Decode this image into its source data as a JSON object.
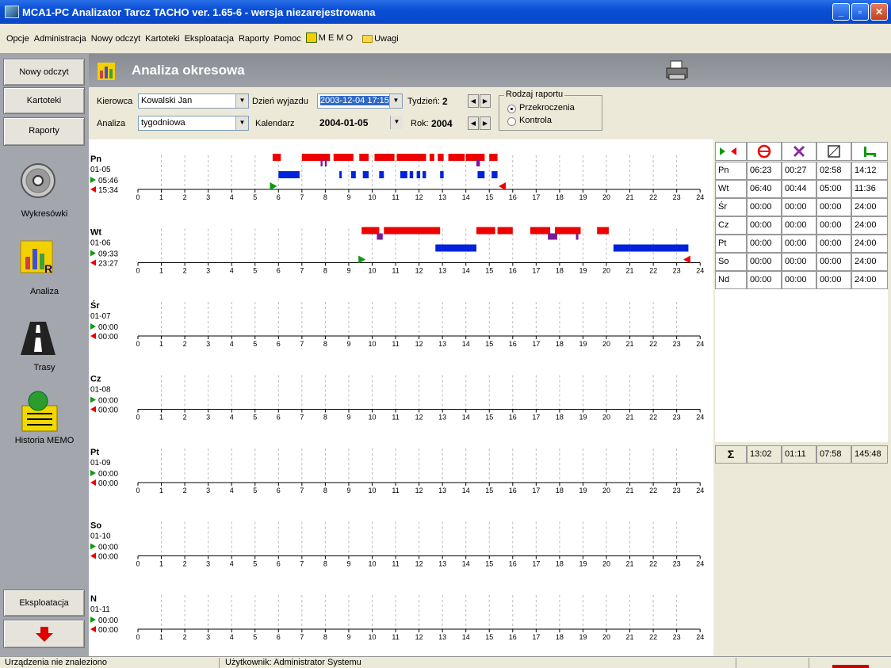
{
  "window": {
    "title": "MCA1-PC Analizator Tarcz TACHO  ver. 1.65-6   - wersja niezarejestrowana"
  },
  "menu": [
    "Opcje",
    "Administracja",
    "Nowy odczyt",
    "Kartoteki",
    "Eksploatacja",
    "Raporty",
    "Pomoc"
  ],
  "menu_memo": "M E M O",
  "menu_uwagi": "Uwagi",
  "sidebar": {
    "nowy_odczyt": "Nowy odczyt",
    "kartoteki": "Kartoteki",
    "raporty": "Raporty",
    "wykresowki": "Wykresówki",
    "analiza": "Analiza",
    "trasy": "Trasy",
    "historia": "Historia MEMO",
    "eksploatacja": "Eksploatacja"
  },
  "header": {
    "title": "Analiza okresowa"
  },
  "form": {
    "kierowca_label": "Kierowca",
    "kierowca_value": "Kowalski Jan",
    "dzien_label": "Dzień wyjazdu",
    "dzien_value": "2003-12-04 17:15",
    "tydzien_label": "Tydzień:",
    "tydzien_value": "2",
    "analiza_label": "Analiza",
    "analiza_value": "tygodniowa",
    "kalendarz_label": "Kalendarz",
    "kalendarz_value": "2004-01-05",
    "rok_label": "Rok:",
    "rok_value": "2004",
    "rodzaj_label": "Rodzaj raportu",
    "opt1": "Przekroczenia",
    "opt2": "Kontrola"
  },
  "colors": {
    "red": "#ee0000",
    "blue": "#0022dd",
    "purple": "#7a1a9a",
    "green": "#119911"
  },
  "days": [
    {
      "name": "Pn",
      "date": "01-05",
      "start": "05:46",
      "end": "15:34",
      "start_h": 5.77,
      "end_h": 15.57,
      "red": [
        [
          5.75,
          6.1
        ],
        [
          7.0,
          8.2
        ],
        [
          8.35,
          9.2
        ],
        [
          9.45,
          9.85
        ],
        [
          10.1,
          10.95
        ],
        [
          11.05,
          12.3
        ],
        [
          12.45,
          12.65
        ],
        [
          12.8,
          13.05
        ],
        [
          13.25,
          13.95
        ],
        [
          14.0,
          14.8
        ],
        [
          15.0,
          15.35
        ]
      ],
      "purple": [
        [
          7.8,
          7.88
        ],
        [
          7.98,
          8.06
        ],
        [
          14.45,
          14.6
        ]
      ],
      "blue": [
        [
          6.0,
          6.9
        ],
        [
          8.6,
          8.7
        ],
        [
          9.1,
          9.3
        ],
        [
          9.6,
          9.85
        ],
        [
          10.3,
          10.5
        ],
        [
          11.2,
          11.5
        ],
        [
          11.6,
          11.75
        ],
        [
          11.9,
          12.05
        ],
        [
          12.15,
          12.3
        ],
        [
          12.9,
          13.05
        ],
        [
          14.5,
          14.8
        ],
        [
          15.1,
          15.35
        ]
      ]
    },
    {
      "name": "Wt",
      "date": "01-06",
      "start": "09:33",
      "end": "23:27",
      "start_h": 9.55,
      "end_h": 23.45,
      "red": [
        [
          9.55,
          10.3
        ],
        [
          10.5,
          12.9
        ],
        [
          14.45,
          15.25
        ],
        [
          15.35,
          16.0
        ],
        [
          16.75,
          17.6
        ],
        [
          17.8,
          18.9
        ],
        [
          19.6,
          20.1
        ]
      ],
      "purple": [
        [
          10.2,
          10.45
        ],
        [
          17.5,
          17.9
        ],
        [
          18.7,
          18.8
        ]
      ],
      "blue": [
        [
          12.7,
          14.45
        ],
        [
          20.3,
          23.5
        ]
      ]
    },
    {
      "name": "Śr",
      "date": "01-07",
      "start": "00:00",
      "end": "00:00",
      "red": [],
      "purple": [],
      "blue": []
    },
    {
      "name": "Cz",
      "date": "01-08",
      "start": "00:00",
      "end": "00:00",
      "red": [],
      "purple": [],
      "blue": []
    },
    {
      "name": "Pt",
      "date": "01-09",
      "start": "00:00",
      "end": "00:00",
      "red": [],
      "purple": [],
      "blue": []
    },
    {
      "name": "So",
      "date": "01-10",
      "start": "00:00",
      "end": "00:00",
      "red": [],
      "purple": [],
      "blue": []
    },
    {
      "name": "N",
      "date": "01-11",
      "start": "00:00",
      "end": "00:00",
      "red": [],
      "purple": [],
      "blue": []
    }
  ],
  "hours": [
    "0",
    "1",
    "2",
    "3",
    "4",
    "5",
    "6",
    "7",
    "8",
    "9",
    "10",
    "11",
    "12",
    "13",
    "14",
    "15",
    "16",
    "17",
    "18",
    "19",
    "20",
    "21",
    "22",
    "23",
    "24"
  ],
  "summary": {
    "icons": [
      "start-end-icon",
      "steering-wheel-icon",
      "tools-icon",
      "box-icon",
      "bed-icon"
    ],
    "rows": [
      [
        "Pn",
        "06:23",
        "00:27",
        "02:58",
        "14:12"
      ],
      [
        "Wt",
        "06:40",
        "00:44",
        "05:00",
        "11:36"
      ],
      [
        "Śr",
        "00:00",
        "00:00",
        "00:00",
        "24:00"
      ],
      [
        "Cz",
        "00:00",
        "00:00",
        "00:00",
        "24:00"
      ],
      [
        "Pt",
        "00:00",
        "00:00",
        "00:00",
        "24:00"
      ],
      [
        "So",
        "00:00",
        "00:00",
        "00:00",
        "24:00"
      ],
      [
        "Nd",
        "00:00",
        "00:00",
        "00:00",
        "24:00"
      ]
    ],
    "sum_symbol": "Σ",
    "totals": [
      "13:02",
      "01:11",
      "07:58",
      "145:48"
    ]
  },
  "status": {
    "device": "Urządzenia nie znaleziono",
    "user": "Użytkownik: Administrator Systemu"
  }
}
